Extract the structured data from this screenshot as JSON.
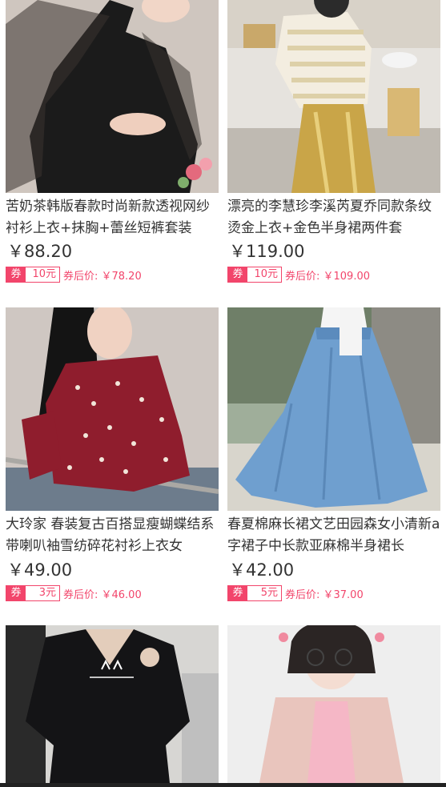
{
  "products": [
    {
      "title": "苦奶茶韩版春款时尚新款透视网纱衬衫上衣+抹胸+蕾丝短裤套装",
      "price": "￥88.20",
      "coupon_tag": "券",
      "coupon_amount": "10元",
      "after_coupon": "券后价: ￥78.20"
    },
    {
      "title": "漂亮的李慧珍李溪芮夏乔同款条纹烫金上衣+金色半身裙两件套",
      "price": "￥119.00",
      "coupon_tag": "券",
      "coupon_amount": "10元",
      "after_coupon": "券后价: ￥109.00"
    },
    {
      "title": "大玲家 春装复古百搭显瘦蝴蝶结系带喇叭袖雪纺碎花衬衫上衣女",
      "price": "￥49.00",
      "coupon_tag": "券",
      "coupon_amount": "3元",
      "after_coupon": "券后价: ￥46.00"
    },
    {
      "title": "春夏棉麻长裙文艺田园森女小清新a字裙子中长款亚麻棉半身裙长",
      "price": "￥42.00",
      "coupon_tag": "券",
      "coupon_amount": "5元",
      "after_coupon": "券后价: ￥37.00"
    },
    {},
    {}
  ],
  "colors": {
    "accent": "#f2456b",
    "text": "#333333"
  }
}
